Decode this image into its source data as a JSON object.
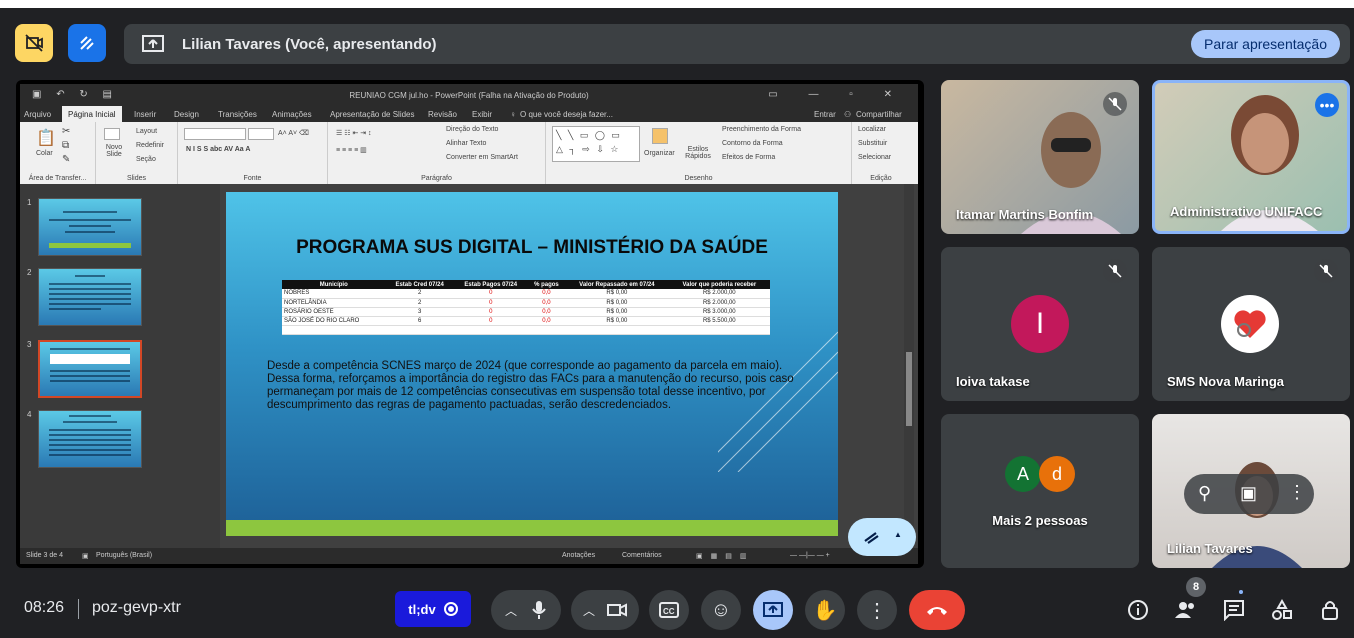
{
  "topbar": {
    "presenting_text": "Lilian Tavares (Você, apresentando)",
    "stop_button": "Parar apresentação"
  },
  "ppt": {
    "title": "REUNIAO CGM jul.ho  -  PowerPoint (Falha na Ativação do Produto)",
    "tabs": [
      "Arquivo",
      "Página Inicial",
      "Inserir",
      "Design",
      "Transições",
      "Animações",
      "Apresentação de Slides",
      "Revisão",
      "Exibir"
    ],
    "tell_me": "O que você deseja fazer...",
    "enter": "Entrar",
    "share": "Compartilhar",
    "ribbon": {
      "colar": "Colar",
      "novo_slide": "Novo Slide",
      "layout": "Layout",
      "redefinir": "Redefinir",
      "secao": "Seção",
      "direcao_texto": "Direção do Texto",
      "alinhar_texto": "Alinhar Texto",
      "converter_smartart": "Converter em SmartArt",
      "organizar": "Organizar",
      "estilos_rapidos": "Estilos Rápidos",
      "preenchimento": "Preenchimento da Forma",
      "contorno": "Contorno da Forma",
      "efeitos": "Efeitos de Forma",
      "localizar": "Localizar",
      "substituir": "Substituir",
      "selecionar": "Selecionar",
      "groups": [
        "Área de Transfer...",
        "Slides",
        "Fonte",
        "Parágrafo",
        "Desenho",
        "Edição"
      ]
    },
    "thumbnails": [
      {
        "num": "1",
        "label": "1ª REUNIÃO CGM"
      },
      {
        "num": "2",
        "label": "PAUTA"
      },
      {
        "num": "3",
        "label": "PROGRAMA SUS DIGITAL – MINISTÉRIO DA SAÚDE"
      },
      {
        "num": "4",
        "label": "OFICINA PLANEJAMENTO"
      }
    ],
    "slide": {
      "title": "PROGRAMA SUS DIGITAL – MINISTÉRIO DA SAÚDE",
      "table_headers": [
        "Município",
        "Estab Cred 07/24",
        "Estab Pagos 07/24",
        "% pagos",
        "Valor Repassado em 07/24",
        "Valor que poderia receber"
      ],
      "table_rows": [
        [
          "NOBRES",
          "2",
          "0",
          "0,0",
          "R$ 0,00",
          "R$ 2.000,00"
        ],
        [
          "NORTELÂNDIA",
          "2",
          "0",
          "0,0",
          "R$ 0,00",
          "R$ 2.000,00"
        ],
        [
          "ROSÁRIO OESTE",
          "3",
          "0",
          "0,0",
          "R$ 0,00",
          "R$ 3.000,00"
        ],
        [
          "SÃO JOSÉ DO RIO CLARO",
          "6",
          "0",
          "0,0",
          "R$ 0,00",
          "R$ 5.500,00"
        ]
      ],
      "body_line1": "Desde a competência SCNES março de 2024 (que corresponde ao pagamento da parcela em maio).",
      "body_line2": "Dessa forma, reforçamos a importância do registro das FACs para a manutenção do recurso, pois caso permaneçam por mais de 12 competências consecutivas em suspensão total desse incentivo, por descumprimento das regras de pagamento pactuadas, serão descredenciados."
    },
    "status": {
      "slide_of": "Slide 3 de 4",
      "language": "Português (Brasil)",
      "notes": "Anotações",
      "comments": "Comentários"
    }
  },
  "participants": [
    {
      "name": "Itamar Martins Bonfim",
      "muted": true
    },
    {
      "name": "Administrativo UNIFACC",
      "muted": false
    },
    {
      "name": "Ioiva takase",
      "initial": "I",
      "muted": true
    },
    {
      "name": "SMS Nova Maringa",
      "muted": true
    },
    {
      "name": "Mais 2 pessoas",
      "initials": [
        "A",
        "d"
      ]
    },
    {
      "name": "Lilian Tavares"
    }
  ],
  "bottombar": {
    "time": "08:26",
    "meeting_code": "poz-gevp-xtr",
    "ext_label": "tl;dv",
    "people_count": "8"
  },
  "colors": {
    "bg": "#202124",
    "accent": "#a8c7fa",
    "end_call": "#ea4335"
  }
}
